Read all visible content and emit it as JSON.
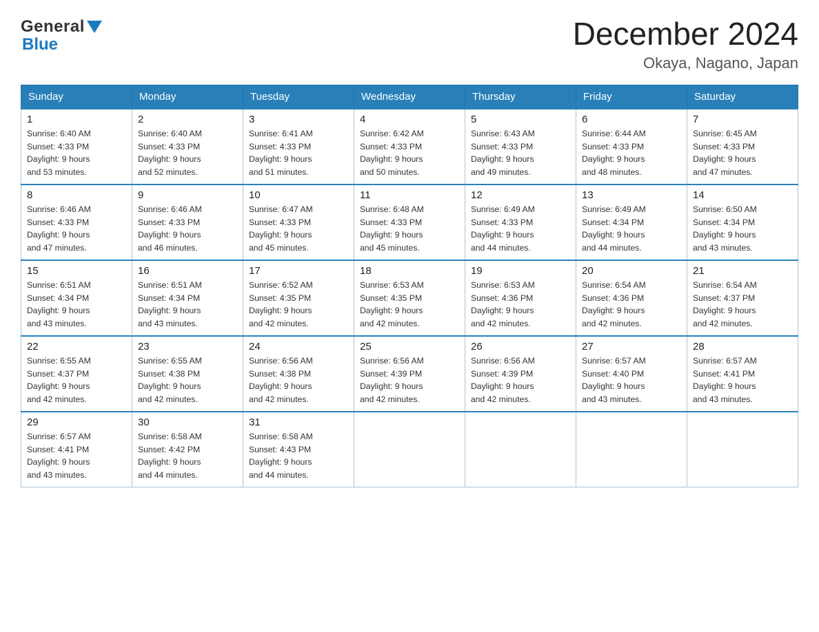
{
  "header": {
    "logo_general": "General",
    "logo_blue": "Blue",
    "title": "December 2024",
    "subtitle": "Okaya, Nagano, Japan"
  },
  "columns": [
    "Sunday",
    "Monday",
    "Tuesday",
    "Wednesday",
    "Thursday",
    "Friday",
    "Saturday"
  ],
  "weeks": [
    [
      {
        "day": "1",
        "info": "Sunrise: 6:40 AM\nSunset: 4:33 PM\nDaylight: 9 hours\nand 53 minutes."
      },
      {
        "day": "2",
        "info": "Sunrise: 6:40 AM\nSunset: 4:33 PM\nDaylight: 9 hours\nand 52 minutes."
      },
      {
        "day": "3",
        "info": "Sunrise: 6:41 AM\nSunset: 4:33 PM\nDaylight: 9 hours\nand 51 minutes."
      },
      {
        "day": "4",
        "info": "Sunrise: 6:42 AM\nSunset: 4:33 PM\nDaylight: 9 hours\nand 50 minutes."
      },
      {
        "day": "5",
        "info": "Sunrise: 6:43 AM\nSunset: 4:33 PM\nDaylight: 9 hours\nand 49 minutes."
      },
      {
        "day": "6",
        "info": "Sunrise: 6:44 AM\nSunset: 4:33 PM\nDaylight: 9 hours\nand 48 minutes."
      },
      {
        "day": "7",
        "info": "Sunrise: 6:45 AM\nSunset: 4:33 PM\nDaylight: 9 hours\nand 47 minutes."
      }
    ],
    [
      {
        "day": "8",
        "info": "Sunrise: 6:46 AM\nSunset: 4:33 PM\nDaylight: 9 hours\nand 47 minutes."
      },
      {
        "day": "9",
        "info": "Sunrise: 6:46 AM\nSunset: 4:33 PM\nDaylight: 9 hours\nand 46 minutes."
      },
      {
        "day": "10",
        "info": "Sunrise: 6:47 AM\nSunset: 4:33 PM\nDaylight: 9 hours\nand 45 minutes."
      },
      {
        "day": "11",
        "info": "Sunrise: 6:48 AM\nSunset: 4:33 PM\nDaylight: 9 hours\nand 45 minutes."
      },
      {
        "day": "12",
        "info": "Sunrise: 6:49 AM\nSunset: 4:33 PM\nDaylight: 9 hours\nand 44 minutes."
      },
      {
        "day": "13",
        "info": "Sunrise: 6:49 AM\nSunset: 4:34 PM\nDaylight: 9 hours\nand 44 minutes."
      },
      {
        "day": "14",
        "info": "Sunrise: 6:50 AM\nSunset: 4:34 PM\nDaylight: 9 hours\nand 43 minutes."
      }
    ],
    [
      {
        "day": "15",
        "info": "Sunrise: 6:51 AM\nSunset: 4:34 PM\nDaylight: 9 hours\nand 43 minutes."
      },
      {
        "day": "16",
        "info": "Sunrise: 6:51 AM\nSunset: 4:34 PM\nDaylight: 9 hours\nand 43 minutes."
      },
      {
        "day": "17",
        "info": "Sunrise: 6:52 AM\nSunset: 4:35 PM\nDaylight: 9 hours\nand 42 minutes."
      },
      {
        "day": "18",
        "info": "Sunrise: 6:53 AM\nSunset: 4:35 PM\nDaylight: 9 hours\nand 42 minutes."
      },
      {
        "day": "19",
        "info": "Sunrise: 6:53 AM\nSunset: 4:36 PM\nDaylight: 9 hours\nand 42 minutes."
      },
      {
        "day": "20",
        "info": "Sunrise: 6:54 AM\nSunset: 4:36 PM\nDaylight: 9 hours\nand 42 minutes."
      },
      {
        "day": "21",
        "info": "Sunrise: 6:54 AM\nSunset: 4:37 PM\nDaylight: 9 hours\nand 42 minutes."
      }
    ],
    [
      {
        "day": "22",
        "info": "Sunrise: 6:55 AM\nSunset: 4:37 PM\nDaylight: 9 hours\nand 42 minutes."
      },
      {
        "day": "23",
        "info": "Sunrise: 6:55 AM\nSunset: 4:38 PM\nDaylight: 9 hours\nand 42 minutes."
      },
      {
        "day": "24",
        "info": "Sunrise: 6:56 AM\nSunset: 4:38 PM\nDaylight: 9 hours\nand 42 minutes."
      },
      {
        "day": "25",
        "info": "Sunrise: 6:56 AM\nSunset: 4:39 PM\nDaylight: 9 hours\nand 42 minutes."
      },
      {
        "day": "26",
        "info": "Sunrise: 6:56 AM\nSunset: 4:39 PM\nDaylight: 9 hours\nand 42 minutes."
      },
      {
        "day": "27",
        "info": "Sunrise: 6:57 AM\nSunset: 4:40 PM\nDaylight: 9 hours\nand 43 minutes."
      },
      {
        "day": "28",
        "info": "Sunrise: 6:57 AM\nSunset: 4:41 PM\nDaylight: 9 hours\nand 43 minutes."
      }
    ],
    [
      {
        "day": "29",
        "info": "Sunrise: 6:57 AM\nSunset: 4:41 PM\nDaylight: 9 hours\nand 43 minutes."
      },
      {
        "day": "30",
        "info": "Sunrise: 6:58 AM\nSunset: 4:42 PM\nDaylight: 9 hours\nand 44 minutes."
      },
      {
        "day": "31",
        "info": "Sunrise: 6:58 AM\nSunset: 4:43 PM\nDaylight: 9 hours\nand 44 minutes."
      },
      {
        "day": "",
        "info": ""
      },
      {
        "day": "",
        "info": ""
      },
      {
        "day": "",
        "info": ""
      },
      {
        "day": "",
        "info": ""
      }
    ]
  ]
}
